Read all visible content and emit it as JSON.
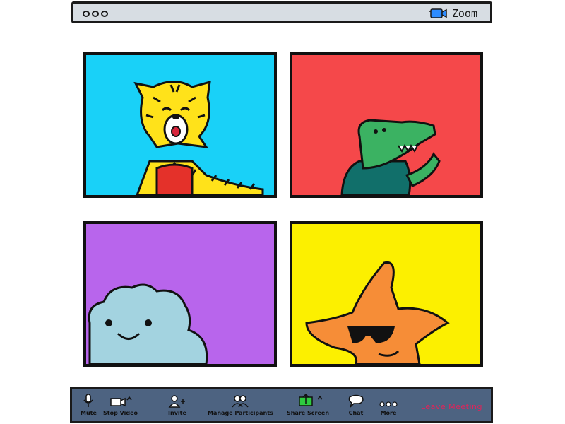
{
  "app": {
    "name": "Zoom"
  },
  "window": {
    "dots": [
      "",
      "",
      ""
    ]
  },
  "tiles": [
    {
      "id": "tiger",
      "background": "#19d1f8"
    },
    {
      "id": "crocodile",
      "background": "#f5484a"
    },
    {
      "id": "cloud",
      "background": "#b865ec"
    },
    {
      "id": "starfish",
      "background": "#fcf000"
    }
  ],
  "toolbar": {
    "mute": "Mute",
    "stop_video": "Stop Video",
    "invite": "Invite",
    "manage_participants": "Manage Participants",
    "share_screen": "Share Screen",
    "chat": "Chat",
    "more": "More",
    "leave": "Leave Meeting"
  },
  "colors": {
    "toolbar_bg": "#4d6381",
    "titlebar_bg": "#d7dde3",
    "leave_text": "#e0245a",
    "share_green": "#2ecc40",
    "zoom_blue": "#2d8cff"
  }
}
